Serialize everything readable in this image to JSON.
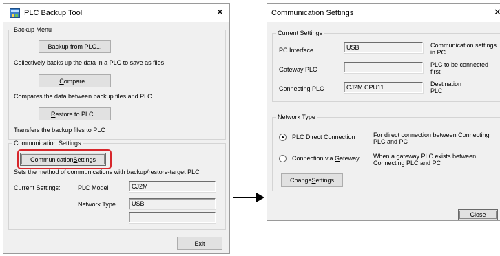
{
  "left_window": {
    "title": "PLC Backup Tool",
    "close_glyph": "✕",
    "backup_menu": {
      "legend": "Backup Menu",
      "backup_button_pre": "",
      "backup_button_key": "B",
      "backup_button_post": "ackup from PLC...",
      "backup_desc": "Collectively backs up the data in a PLC to save as files",
      "compare_button_pre": "",
      "compare_button_key": "C",
      "compare_button_post": "ompare...",
      "compare_desc": "Compares the data between backup files and PLC",
      "restore_button_pre": "",
      "restore_button_key": "R",
      "restore_button_post": "estore to PLC...",
      "restore_desc": "Transfers the backup files to PLC"
    },
    "comm_settings": {
      "legend": "Communication Settings",
      "button_pre": "Communication ",
      "button_key": "S",
      "button_post": "ettings",
      "desc": "Sets the method of communications with backup/restore-target PLC",
      "current_label": "Current Settings:",
      "plc_model_label": "PLC Model",
      "plc_model_value": "CJ2M",
      "network_type_label": "Network Type",
      "network_type_value": "USB",
      "extra_value": ""
    },
    "exit_label": "Exit"
  },
  "arrow_icon": "right-arrow-icon",
  "right_window": {
    "title": "Communication Settings",
    "close_glyph": "✕",
    "current_settings": {
      "legend": "Current Settings",
      "rows": [
        {
          "label": "PC Interface",
          "value": "USB",
          "note": "Communication settings in PC"
        },
        {
          "label": "Gateway PLC",
          "value": "",
          "note": "PLC to be connected first"
        },
        {
          "label": "Connecting PLC",
          "value": "CJ2M CPU11",
          "note": "Destination PLC"
        }
      ]
    },
    "network_type": {
      "legend": "Network Type",
      "direct_pre": "",
      "direct_key": "P",
      "direct_post": "LC Direct Connection",
      "direct_desc": "For direct connection between Connecting PLC and PC",
      "direct_selected": true,
      "gateway_pre": "Connection via ",
      "gateway_key": "G",
      "gateway_post": "ateway",
      "gateway_desc": "When a gateway PLC exists between Connecting PLC and PC",
      "gateway_selected": false,
      "change_pre": "Change ",
      "change_key": "S",
      "change_post": "ettings"
    },
    "close_label": "Close"
  },
  "colors": {
    "highlight": "#d7262b",
    "window_bg": "#f0f0f0",
    "button_bg": "#e1e1e1"
  }
}
